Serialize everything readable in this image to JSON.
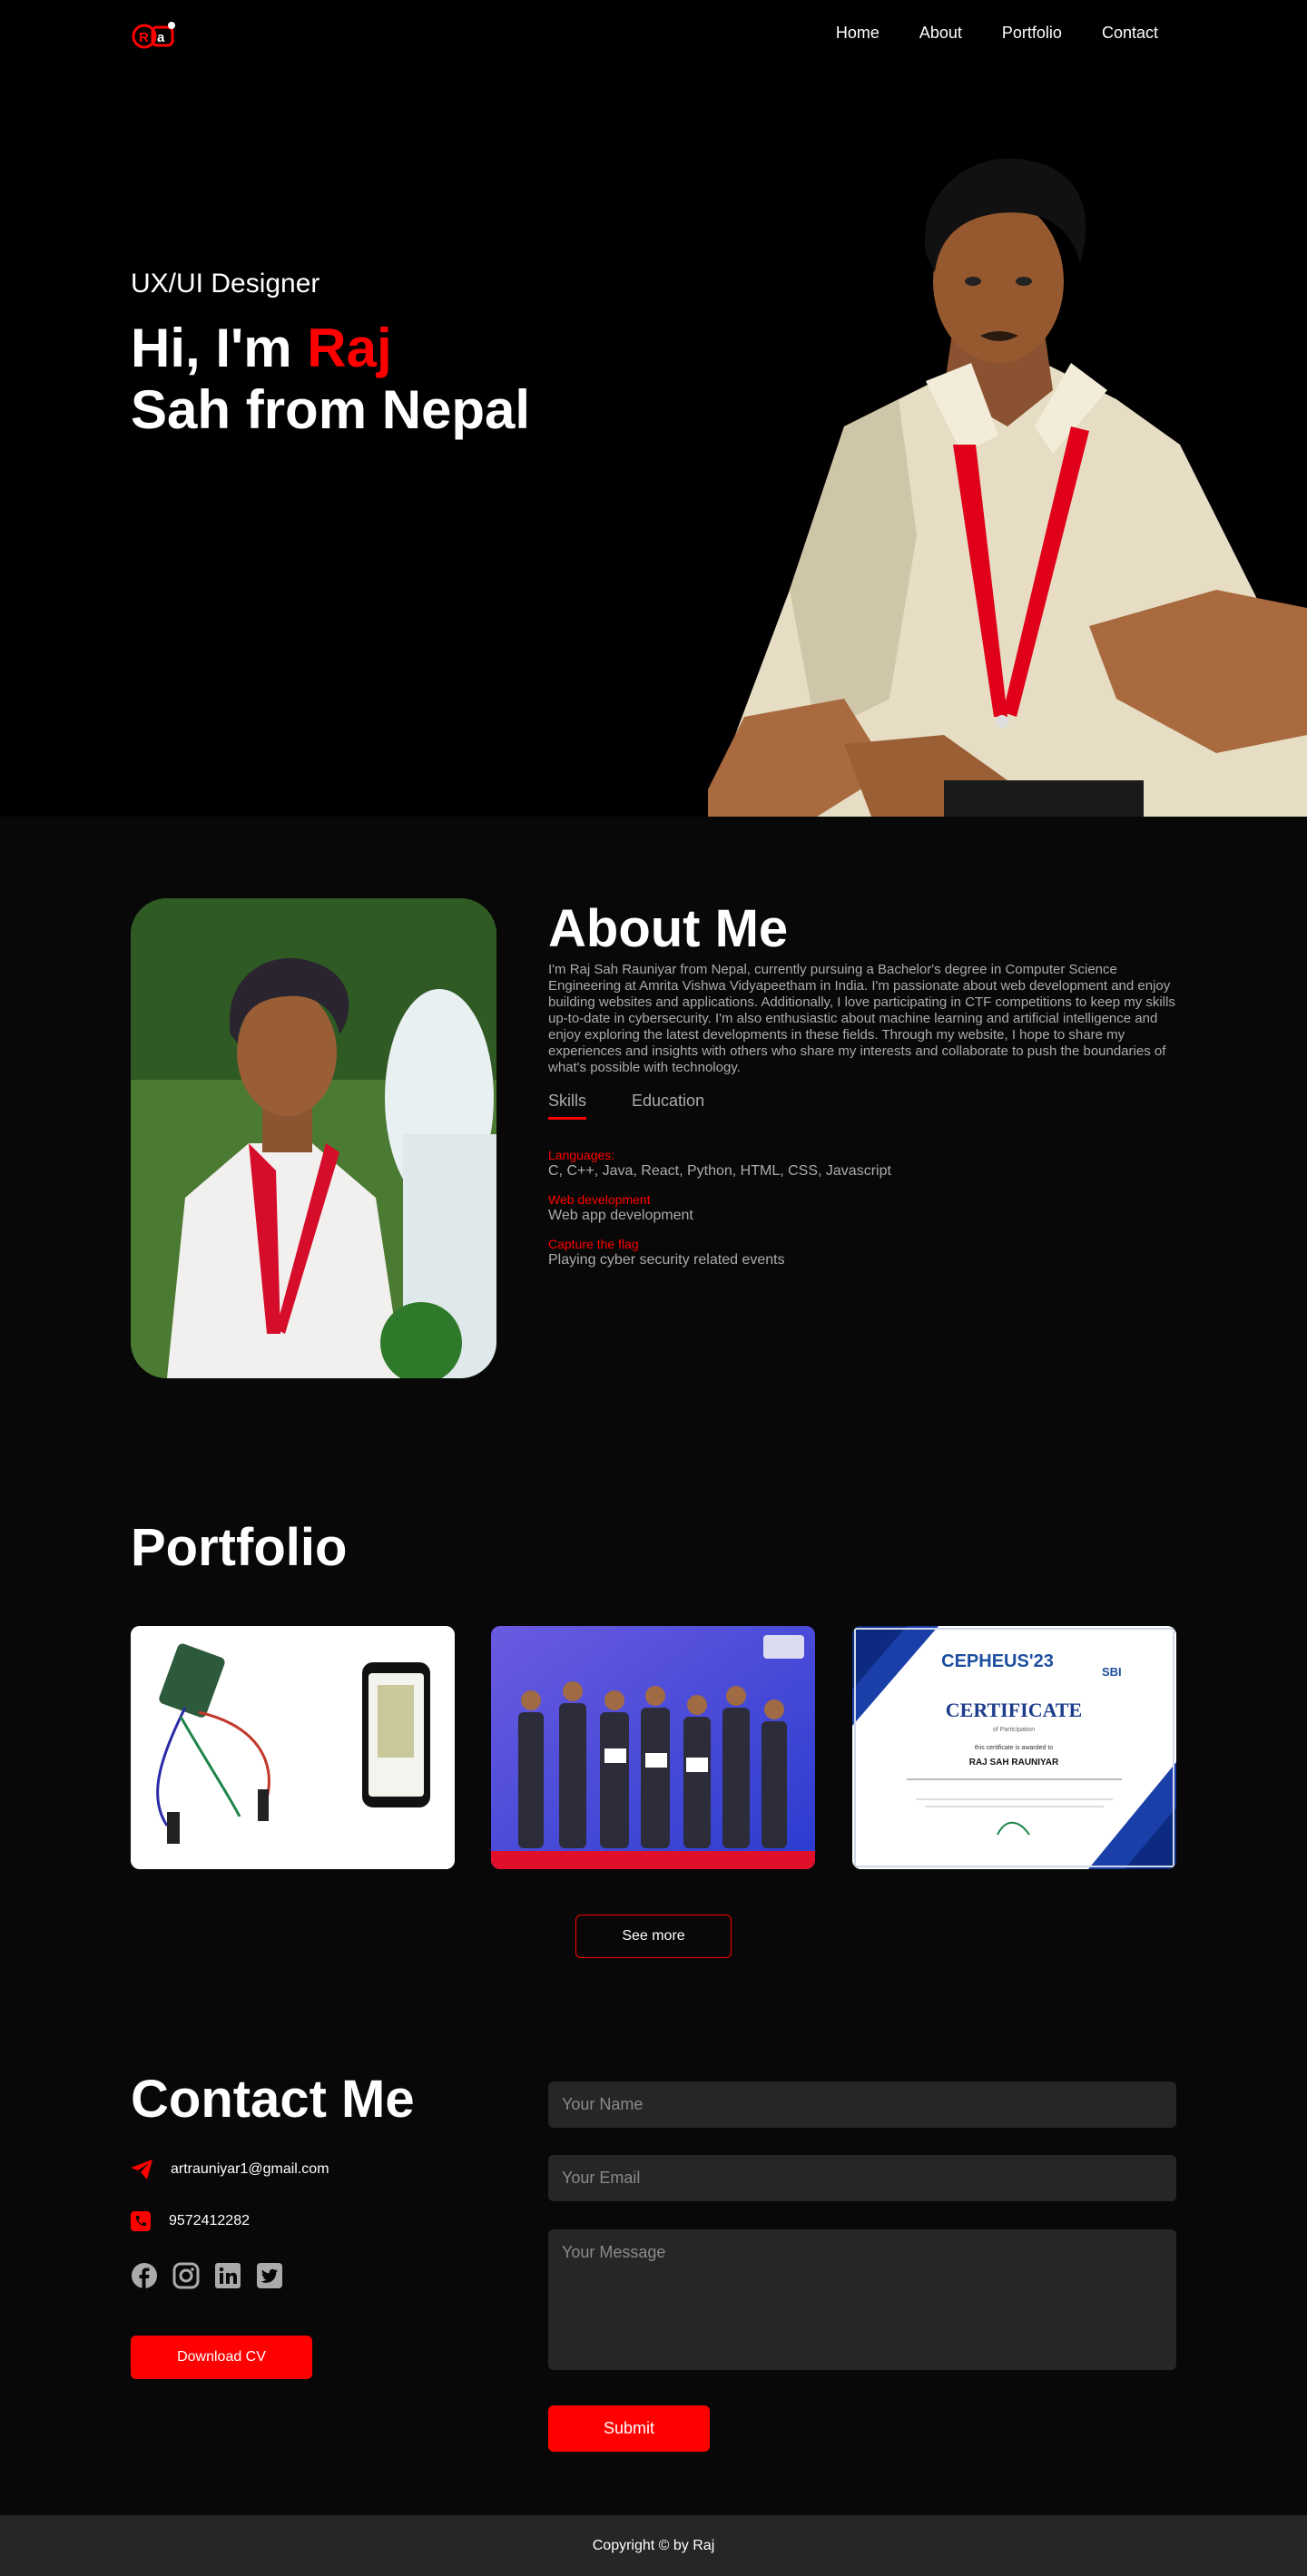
{
  "header": {
    "nav": [
      "Home",
      "About",
      "Portfolio",
      "Contact"
    ]
  },
  "hero": {
    "subtitle": "UX/UI Designer",
    "greeting": "Hi, I'm ",
    "name_highlight": "Raj",
    "name_rest": "Sah from Nepal"
  },
  "about": {
    "title": "About Me",
    "text": "I'm Raj Sah Rauniyar from Nepal, currently pursuing a Bachelor's degree in Computer Science Engineering at Amrita Vishwa Vidyapeetham in India. I'm passionate about web development and enjoy building websites and applications. Additionally, I love participating in CTF competitions to keep my skills up-to-date in cybersecurity. I'm also enthusiastic about machine learning and artificial intelligence and enjoy exploring the latest developments in these fields. Through my website, I hope to share my experiences and insights with others who share my interests and collaborate to push the boundaries of what's possible with technology.",
    "tabs": [
      "Skills",
      "Education"
    ],
    "skills": [
      {
        "label": "Languages:",
        "value": "C, C++, Java, React, Python, HTML, CSS, Javascript"
      },
      {
        "label": "Web development",
        "value": "Web app development"
      },
      {
        "label": "Capture the flag",
        "value": "Playing cyber security related events"
      }
    ]
  },
  "portfolio": {
    "title": "Portfolio",
    "see_more": "See more",
    "certificate": {
      "heading": "CERTIFICATE",
      "sub": "of Participation",
      "awarded": "this certificate is awarded to",
      "name": "RAJ SAH RAUNIYAR",
      "event": "CEPHEUS'23",
      "sponsor": "SBI"
    }
  },
  "contact": {
    "title": "Contact Me",
    "email": "artrauniyar1@gmail.com",
    "phone": "9572412282",
    "download_cv": "Download CV",
    "name_placeholder": "Your Name",
    "email_placeholder": "Your Email",
    "message_placeholder": "Your Message",
    "submit": "Submit"
  },
  "footer": {
    "copyright": "Copyright © by Raj"
  },
  "colors": {
    "accent": "#ff0000",
    "background": "#080808",
    "field": "#262626"
  }
}
